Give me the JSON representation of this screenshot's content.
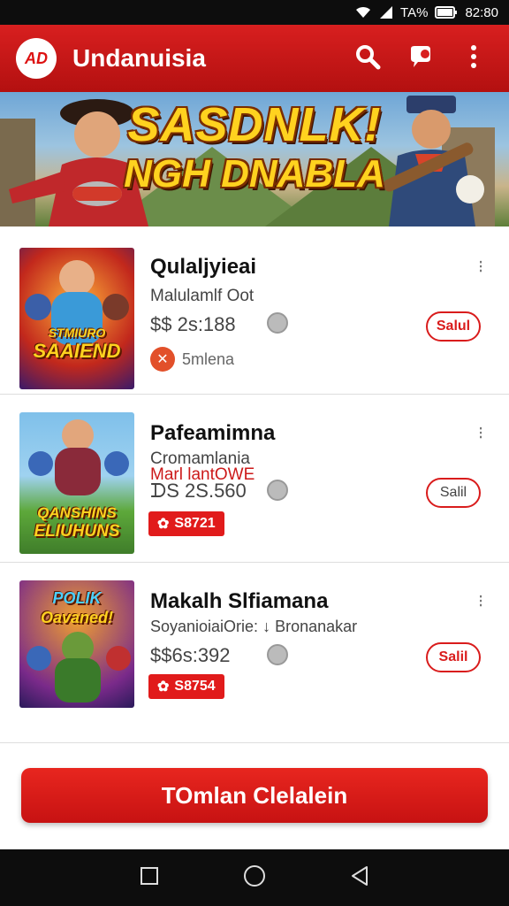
{
  "status_bar": {
    "battery_text": "TA%",
    "time": "82:80"
  },
  "app_bar": {
    "logo_text": "AD",
    "title": "Undanuisia"
  },
  "banner": {
    "line1": "SASDNLK!",
    "line2": "NGH DNABLA"
  },
  "items": [
    {
      "name": "Qulaljyieai",
      "subtitle": "Malulamlf Oot",
      "subtitle2": "",
      "price": "$$ 2s:188",
      "tag_text": "5mlena",
      "badge": "",
      "action_label": "Salul",
      "thumb_title": "SAAIEND",
      "thumb_title_top": "STMIURO"
    },
    {
      "name": "Pafeamimna",
      "subtitle": "Cromamlania",
      "subtitle2": "Marl lantOWE",
      "price": "ᗪS 2S.560",
      "tag_text": "",
      "badge": "S8721",
      "action_label": "Salil",
      "thumb_title": "ELIUHUNS",
      "thumb_title_top": "QANSHINS"
    },
    {
      "name": "Makalh Slfiamana",
      "subtitle": "SoyanioiaiOrie: ↓ Bronanakar",
      "subtitle2": "",
      "price": "$$6s:392",
      "tag_text": "",
      "badge": "S8754",
      "action_label": "Salil",
      "thumb_title": "Oavaned!",
      "thumb_title_top": "POLIK"
    }
  ],
  "cta_label": "TOmlan Clelalein",
  "colors": {
    "brand_red": "#d81f1f",
    "banner_text": "#ffd21f"
  }
}
